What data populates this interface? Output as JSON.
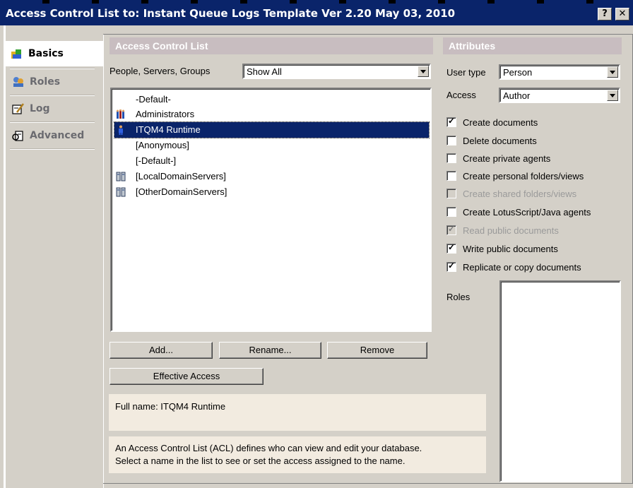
{
  "window": {
    "title": "Access Control List to: Instant Queue Logs Template Ver 2.20 May 03, 2010",
    "help_label": "?",
    "close_label": "✕"
  },
  "tabs": [
    {
      "label": "Basics",
      "icon": "basics-icon",
      "active": true
    },
    {
      "label": "Roles",
      "icon": "roles-icon",
      "active": false
    },
    {
      "label": "Log",
      "icon": "log-icon",
      "active": false
    },
    {
      "label": "Advanced",
      "icon": "advanced-icon",
      "active": false
    }
  ],
  "acl": {
    "header": "Access Control List",
    "filter_label": "People, Servers, Groups",
    "filter_value": "Show All",
    "entries": [
      {
        "name": "-Default-",
        "icon": ""
      },
      {
        "name": "Administrators",
        "icon": "group-icon"
      },
      {
        "name": "ITQM4 Runtime",
        "icon": "person-icon",
        "selected": true
      },
      {
        "name": "[Anonymous]",
        "icon": ""
      },
      {
        "name": "[-Default-]",
        "icon": ""
      },
      {
        "name": "[LocalDomainServers]",
        "icon": "server-group-icon"
      },
      {
        "name": "[OtherDomainServers]",
        "icon": "server-group-icon"
      }
    ],
    "buttons": {
      "add": "Add...",
      "rename": "Rename...",
      "remove": "Remove",
      "effective_access": "Effective Access"
    },
    "full_name": "Full name: ITQM4 Runtime",
    "help_text_1": "An Access Control List (ACL) defines who can view and edit your database.",
    "help_text_2": "Select a name in the list to see or set the access assigned to the name."
  },
  "attributes": {
    "header": "Attributes",
    "user_type_label": "User type",
    "user_type_value": "Person",
    "access_label": "Access",
    "access_value": "Author",
    "checkboxes": [
      {
        "label": "Create documents",
        "checked": true,
        "disabled": false
      },
      {
        "label": "Delete documents",
        "checked": false,
        "disabled": false
      },
      {
        "label": "Create private agents",
        "checked": false,
        "disabled": false
      },
      {
        "label": "Create personal folders/views",
        "checked": false,
        "disabled": false
      },
      {
        "label": "Create shared folders/views",
        "checked": false,
        "disabled": true
      },
      {
        "label": "Create LotusScript/Java agents",
        "checked": false,
        "disabled": false
      },
      {
        "label": "Read public documents",
        "checked": true,
        "disabled": true
      },
      {
        "label": "Write public documents",
        "checked": true,
        "disabled": false
      },
      {
        "label": "Replicate or copy documents",
        "checked": true,
        "disabled": false
      }
    ],
    "roles_label": "Roles"
  }
}
